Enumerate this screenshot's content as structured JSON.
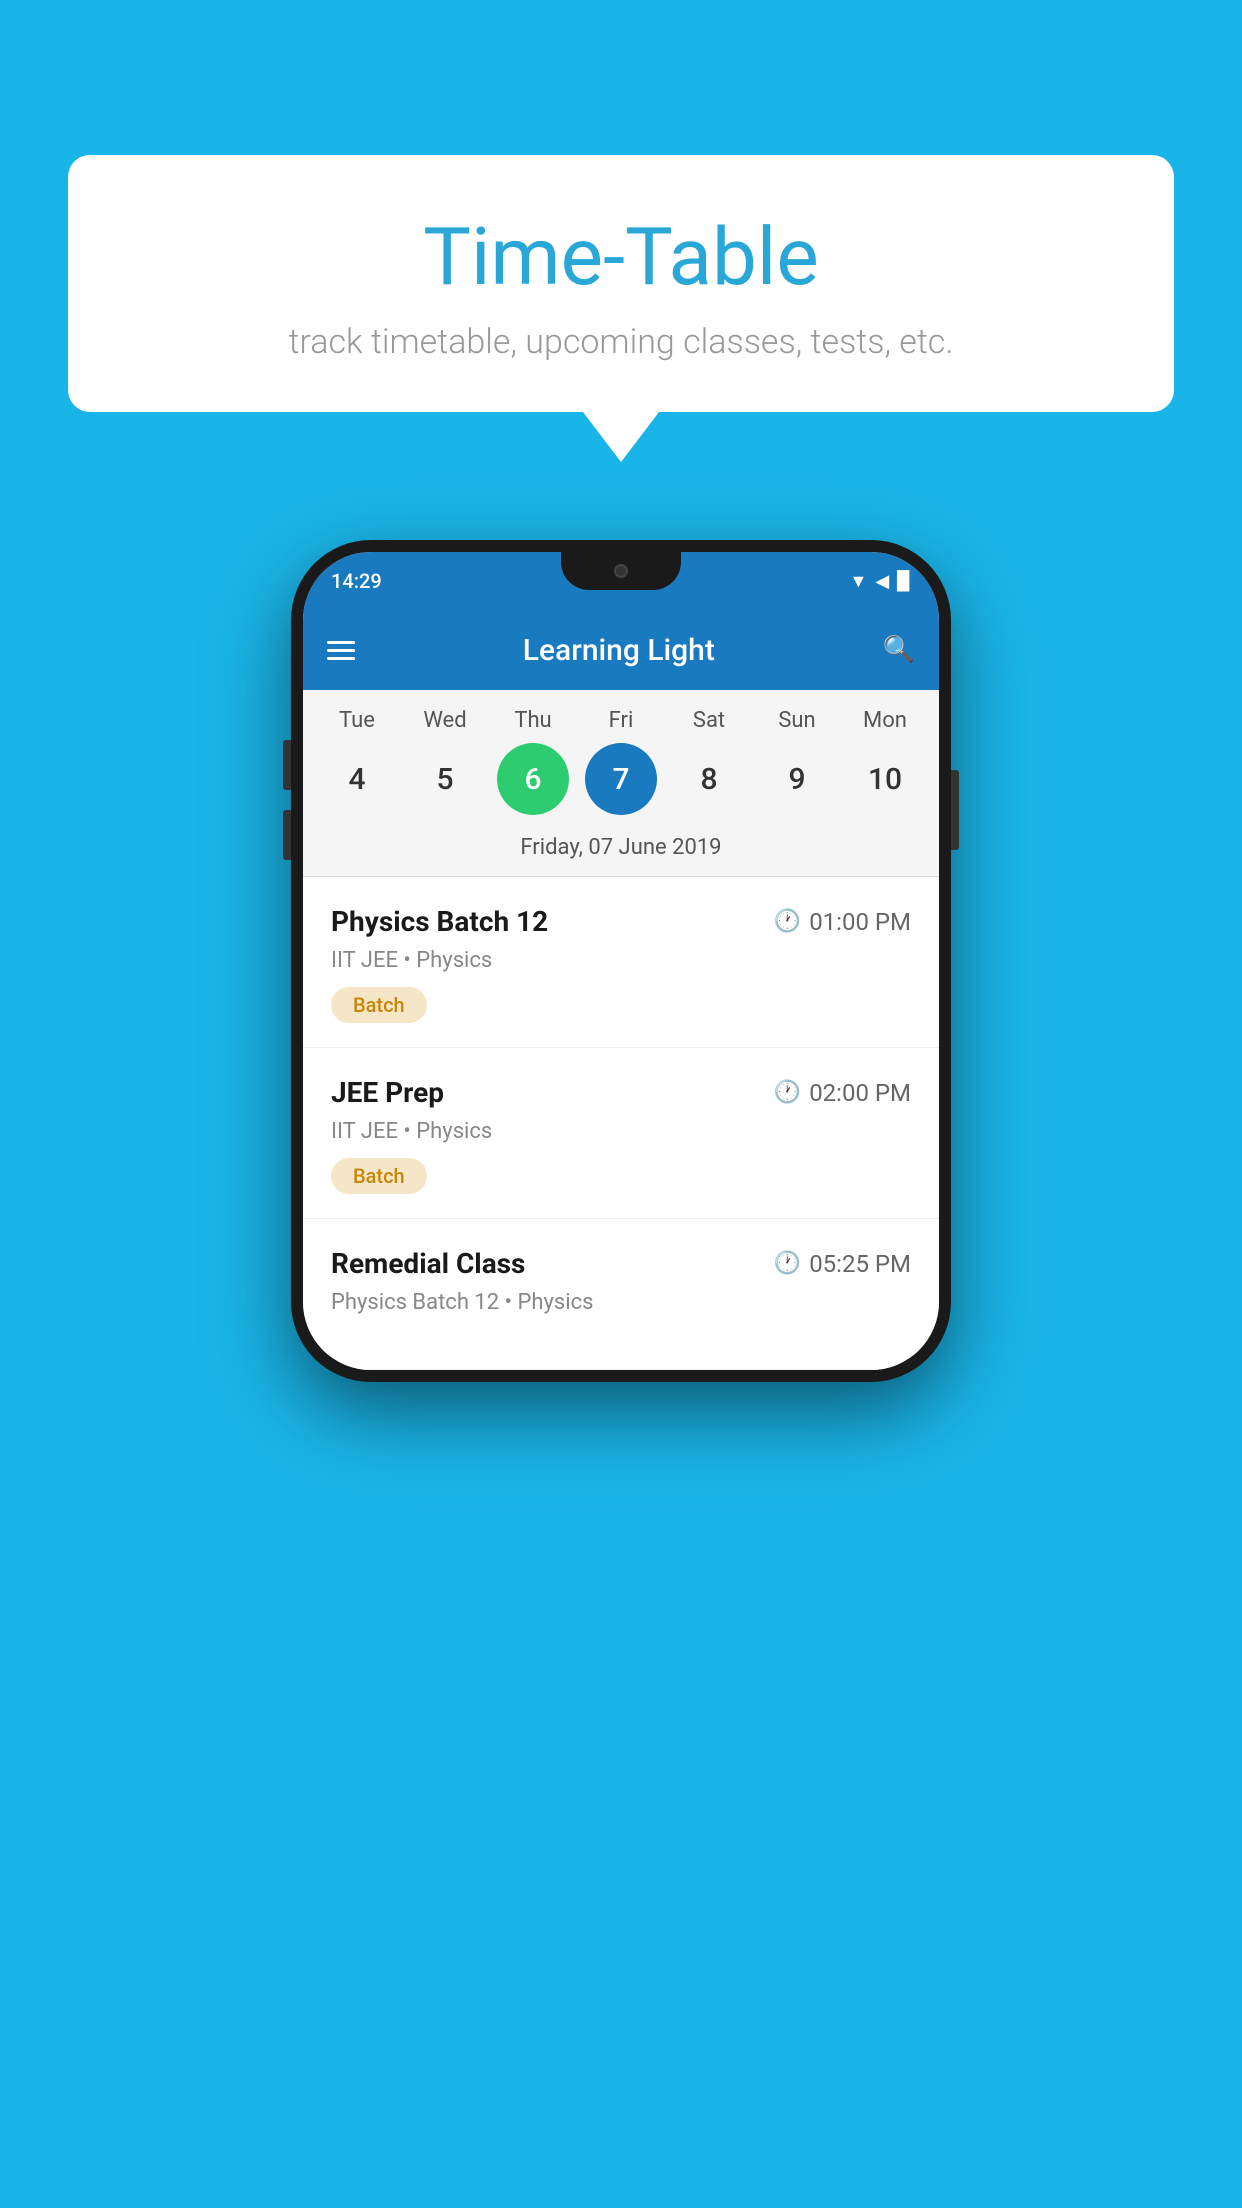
{
  "background_color": "#1ab5e8",
  "speech_bubble": {
    "title": "Time-Table",
    "subtitle": "track timetable, upcoming classes, tests, etc."
  },
  "phone": {
    "status_bar": {
      "time": "14:29"
    },
    "app_header": {
      "title": "Learning Light"
    },
    "calendar": {
      "days": [
        {
          "name": "Tue",
          "number": "4",
          "state": "normal"
        },
        {
          "name": "Wed",
          "number": "5",
          "state": "normal"
        },
        {
          "name": "Thu",
          "number": "6",
          "state": "today"
        },
        {
          "name": "Fri",
          "number": "7",
          "state": "selected"
        },
        {
          "name": "Sat",
          "number": "8",
          "state": "normal"
        },
        {
          "name": "Sun",
          "number": "9",
          "state": "normal"
        },
        {
          "name": "Mon",
          "number": "10",
          "state": "normal"
        }
      ],
      "selected_date_label": "Friday, 07 June 2019"
    },
    "classes": [
      {
        "name": "Physics Batch 12",
        "time": "01:00 PM",
        "subject": "IIT JEE • Physics",
        "badge": "Batch"
      },
      {
        "name": "JEE Prep",
        "time": "02:00 PM",
        "subject": "IIT JEE • Physics",
        "badge": "Batch"
      },
      {
        "name": "Remedial Class",
        "time": "05:25 PM",
        "subject": "Physics Batch 12 • Physics",
        "badge": null
      }
    ]
  }
}
